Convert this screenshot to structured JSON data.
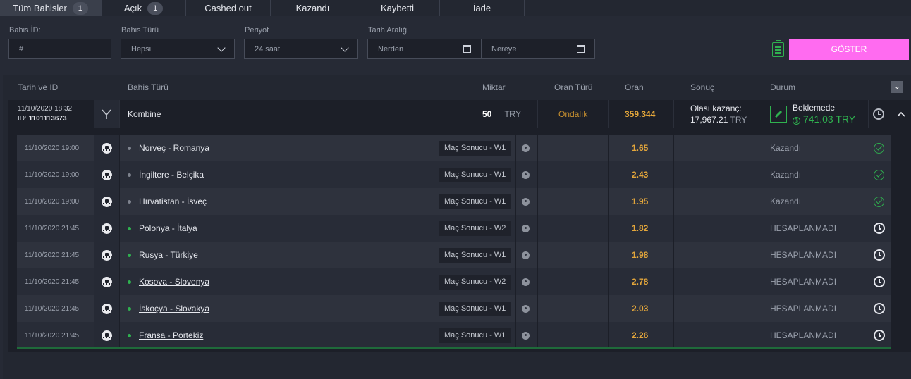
{
  "tabs": [
    {
      "label": "Tüm Bahisler",
      "count": "1"
    },
    {
      "label": "Açık",
      "count": "1"
    },
    {
      "label": "Cashed out",
      "count": ""
    },
    {
      "label": "Kazandı",
      "count": ""
    },
    {
      "label": "Kaybetti",
      "count": ""
    },
    {
      "label": "İade",
      "count": ""
    }
  ],
  "filters": {
    "bet_id_label": "Bahis İD:",
    "bet_id_placeholder": "#",
    "bet_type_label": "Bahis Türü",
    "bet_type_value": "Hepsi",
    "period_label": "Periyot",
    "period_value": "24 saat",
    "date_range_label": "Tarih Aralığı",
    "from_placeholder": "Nerden",
    "to_placeholder": "Nereye",
    "show_button": "GÖSTER"
  },
  "headers": {
    "date_id": "Tarih ve ID",
    "bet_type": "Bahis Türü",
    "amount": "Miktar",
    "odds_type": "Oran Türü",
    "odds": "Oran",
    "result": "Sonuç",
    "status": "Durum"
  },
  "bet": {
    "datetime": "11/10/2020 18:32",
    "id_prefix": "ID:",
    "id": "1101113673",
    "type": "Kombine",
    "amount": "50",
    "currency": "TRY",
    "odds_type": "Ondalık",
    "odds": "359.344",
    "potential_label": "Olası kazanç:",
    "potential_value": "17,967.21",
    "potential_currency": "TRY",
    "status": "Beklemede",
    "cashout_symbol": "$",
    "cashout_value": "741.03 TRY"
  },
  "events": [
    {
      "date": "11/10/2020 19:00",
      "match": "Norveç - Romanya",
      "market": "Maç Sonucu - W1",
      "odds": "1.65",
      "status": "Kazandı",
      "live": false,
      "icon": "check-circle-icon"
    },
    {
      "date": "11/10/2020 19:00",
      "match": "İngiltere - Belçika",
      "market": "Maç Sonucu - W1",
      "odds": "2.43",
      "status": "Kazandı",
      "live": false,
      "icon": "check-circle-icon"
    },
    {
      "date": "11/10/2020 19:00",
      "match": "Hırvatistan - İsveç",
      "market": "Maç Sonucu - W1",
      "odds": "1.95",
      "status": "Kazandı",
      "live": false,
      "icon": "check-circle-icon"
    },
    {
      "date": "11/10/2020 21:45",
      "match": "Polonya - İtalya",
      "market": "Maç Sonucu - W2",
      "odds": "1.82",
      "status": "HESAPLANMADI",
      "live": true,
      "icon": "clock-icon"
    },
    {
      "date": "11/10/2020 21:45",
      "match": "Rusya - Türkiye",
      "market": "Maç Sonucu - W1",
      "odds": "1.98",
      "status": "HESAPLANMADI",
      "live": true,
      "icon": "clock-icon"
    },
    {
      "date": "11/10/2020 21:45",
      "match": "Kosova - Slovenya",
      "market": "Maç Sonucu - W2",
      "odds": "2.78",
      "status": "HESAPLANMADI",
      "live": true,
      "icon": "clock-icon"
    },
    {
      "date": "11/10/2020 21:45",
      "match": "İskoçya - Slovakya",
      "market": "Maç Sonucu - W1",
      "odds": "2.03",
      "status": "HESAPLANMADI",
      "live": true,
      "icon": "clock-icon"
    },
    {
      "date": "11/10/2020 21:45",
      "match": "Fransa - Portekiz",
      "market": "Maç Sonucu - W1",
      "odds": "2.26",
      "status": "HESAPLANMADI",
      "live": true,
      "icon": "clock-icon"
    }
  ],
  "colors": {
    "accent_pink": "#ff6bf0",
    "odds_orange": "#e3a63b",
    "win_green": "#2fb14f",
    "odds_type_orange": "#c8902f"
  }
}
